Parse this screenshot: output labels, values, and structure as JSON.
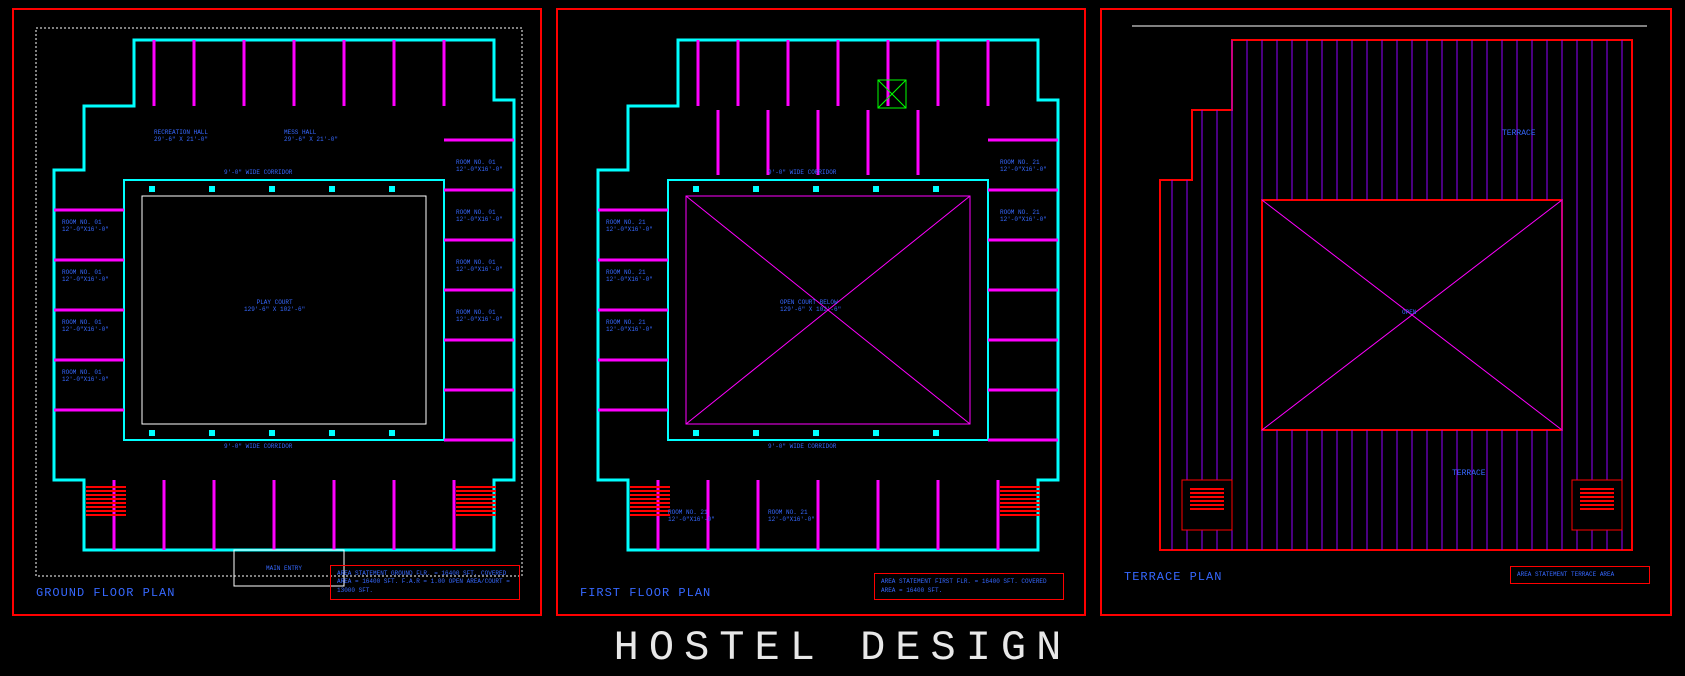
{
  "main_title": "HOSTEL DESIGN",
  "plans": {
    "ground": {
      "title": "GROUND FLOOR PLAN",
      "courtyard_label": "PLAY COURT\\n129'-6\" X 102'-6\"",
      "corridor_label": "9'-0\" WIDE CORRIDOR",
      "room_label": "ROOM NO. 01\\n12'-0\"X16'-0\"",
      "entry_label": "MAIN ENTRY",
      "dining_label": "RECREATION HALL\\n29'-6\" X 21'-0\"",
      "mess_label": "MESS HALL\\n29'-6\" X 21'-0\"",
      "area_box": "AREA STATEMENT\\nGROUND FLR.     = 16400 SFT.\\nCOVERED AREA    = 16400 SFT.\\nF.A.R           = 1.00\\nOPEN AREA/COURT = 13000 SFT."
    },
    "first": {
      "title": "FIRST FLOOR PLAN",
      "courtyard_label": "OPEN COURT BELOW\\n129'-6\" X 102'-6\"",
      "corridor_label": "9'-0\" WIDE CORRIDOR",
      "room_label": "ROOM NO. 21\\n12'-0\"X16'-0\"",
      "area_box": "AREA STATEMENT\\nFIRST FLR.      = 16400 SFT.\\nCOVERED AREA    = 16400 SFT."
    },
    "terrace": {
      "title": "TERRACE PLAN",
      "terrace_label": "TERRACE",
      "open_below_label": "OPEN",
      "area_box": "AREA STATEMENT\\nTERRACE AREA"
    }
  }
}
